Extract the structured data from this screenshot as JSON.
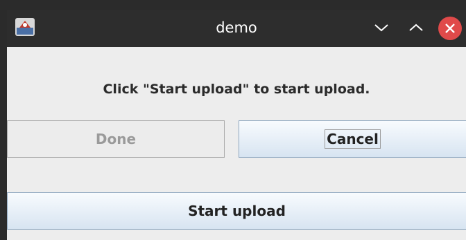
{
  "window": {
    "title": "demo",
    "controls": [
      "minimize-icon",
      "maximize-icon",
      "close-icon"
    ],
    "close_color": "#e04a4a"
  },
  "dialog": {
    "message": "Click \"Start upload\" to start upload.",
    "done_label": "Done",
    "cancel_label": "Cancel",
    "start_label": "Start upload",
    "done_enabled": false
  }
}
